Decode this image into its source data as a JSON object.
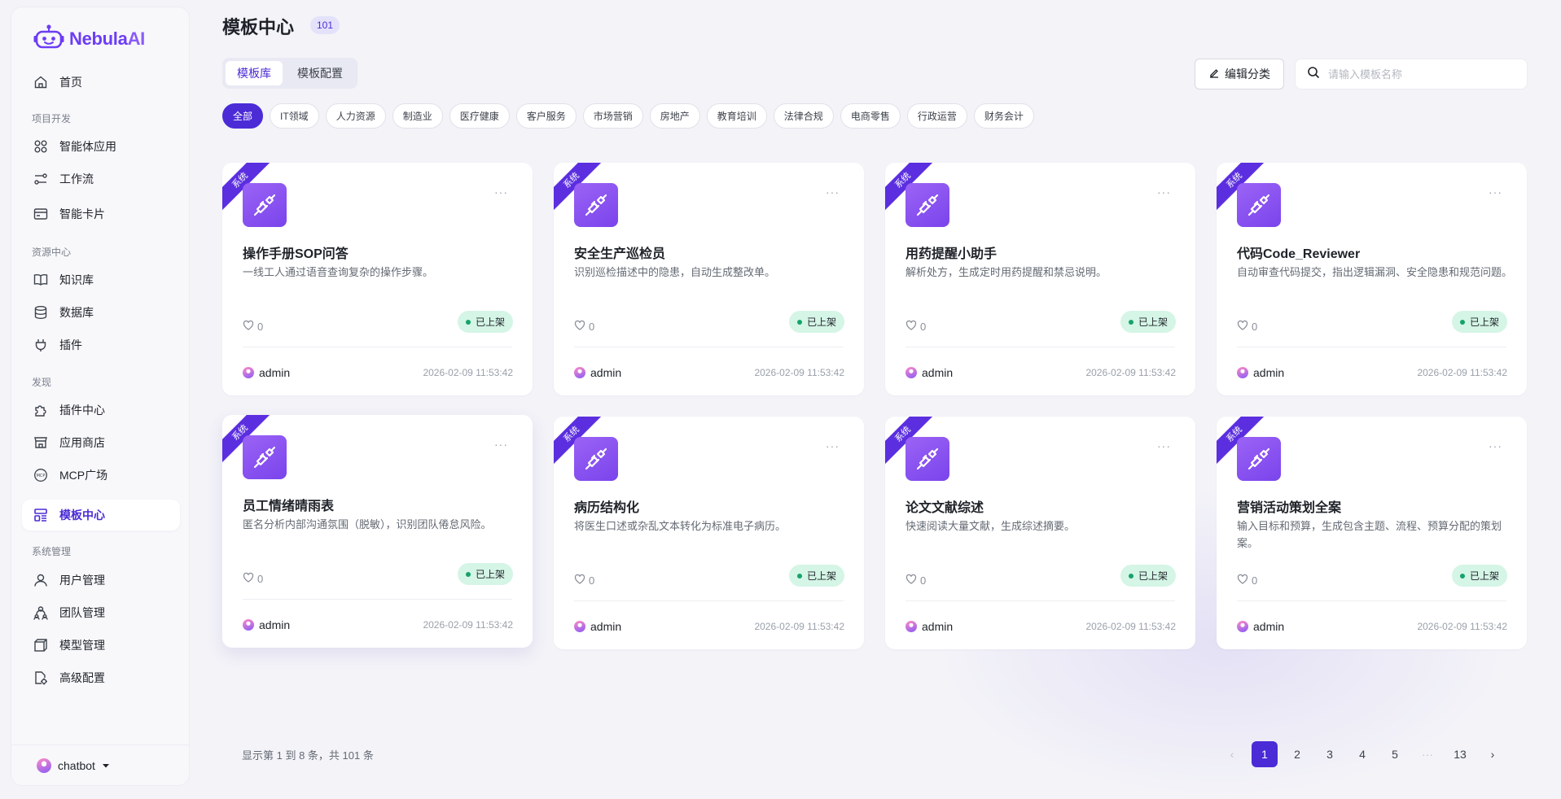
{
  "brand": {
    "name_main": "Nebula",
    "name_ai": "AI"
  },
  "sidebar": {
    "home": "首页",
    "section_dev": "项目开发",
    "agent_apps": "智能体应用",
    "workflow": "工作流",
    "smart_cards": "智能卡片",
    "section_resources": "资源中心",
    "knowledge": "知识库",
    "database": "数据库",
    "plugins": "插件",
    "section_discover": "发现",
    "plugin_center": "插件中心",
    "app_store": "应用商店",
    "mcp_square": "MCP广场",
    "template_center": "模板中心",
    "section_system": "系统管理",
    "users": "用户管理",
    "teams": "团队管理",
    "models": "模型管理",
    "advanced": "高级配置",
    "current_user": "chatbot"
  },
  "header": {
    "title": "模板中心",
    "count": "101",
    "tabs": [
      "模板库",
      "模板配置"
    ],
    "edit_label": "编辑分类",
    "search_placeholder": "请输入模板名称"
  },
  "categories": [
    "全部",
    "IT领域",
    "人力资源",
    "制造业",
    "医疗健康",
    "客户服务",
    "市场营销",
    "房地产",
    "教育培训",
    "法律合规",
    "电商零售",
    "行政运营",
    "财务会计"
  ],
  "cards": [
    {
      "ribbon": "系统",
      "title": "操作手册SOP问答",
      "desc": "一线工人通过语音查询复杂的操作步骤。",
      "likes": "0",
      "status": "已上架",
      "author": "admin",
      "date": "2026-02-09 11:53:42"
    },
    {
      "ribbon": "系统",
      "title": "安全生产巡检员",
      "desc": "识别巡检描述中的隐患，自动生成整改单。",
      "likes": "0",
      "status": "已上架",
      "author": "admin",
      "date": "2026-02-09 11:53:42"
    },
    {
      "ribbon": "系统",
      "title": "用药提醒小助手",
      "desc": "解析处方，生成定时用药提醒和禁忌说明。",
      "likes": "0",
      "status": "已上架",
      "author": "admin",
      "date": "2026-02-09 11:53:42"
    },
    {
      "ribbon": "系统",
      "title": "代码Code_Reviewer",
      "desc": "自动审查代码提交，指出逻辑漏洞、安全隐患和规范问题。",
      "likes": "0",
      "status": "已上架",
      "author": "admin",
      "date": "2026-02-09 11:53:42"
    },
    {
      "ribbon": "系统",
      "title": "员工情绪晴雨表",
      "desc": "匿名分析内部沟通氛围（脱敏），识别团队倦怠风险。",
      "likes": "0",
      "status": "已上架",
      "author": "admin",
      "date": "2026-02-09 11:53:42"
    },
    {
      "ribbon": "系统",
      "title": "病历结构化",
      "desc": "将医生口述或杂乱文本转化为标准电子病历。",
      "likes": "0",
      "status": "已上架",
      "author": "admin",
      "date": "2026-02-09 11:53:42"
    },
    {
      "ribbon": "系统",
      "title": "论文文献综述",
      "desc": "快速阅读大量文献，生成综述摘要。",
      "likes": "0",
      "status": "已上架",
      "author": "admin",
      "date": "2026-02-09 11:53:42"
    },
    {
      "ribbon": "系统",
      "title": "营销活动策划全案",
      "desc": "输入目标和预算，生成包含主题、流程、预算分配的策划案。",
      "likes": "0",
      "status": "已上架",
      "author": "admin",
      "date": "2026-02-09 11:53:42"
    }
  ],
  "card_more": "···",
  "footer": {
    "summary": "显示第 1 到 8 条，共 101 条",
    "pages": [
      "1",
      "2",
      "3",
      "4",
      "5"
    ],
    "ellipsis": "···",
    "last_page": "13",
    "prev": "‹",
    "next": "›"
  },
  "colors": {
    "accent": "#4b2bd6",
    "ribbon": "#5b2ee0",
    "status_bg": "#d5f5e6",
    "status_dot": "#16a36a"
  }
}
